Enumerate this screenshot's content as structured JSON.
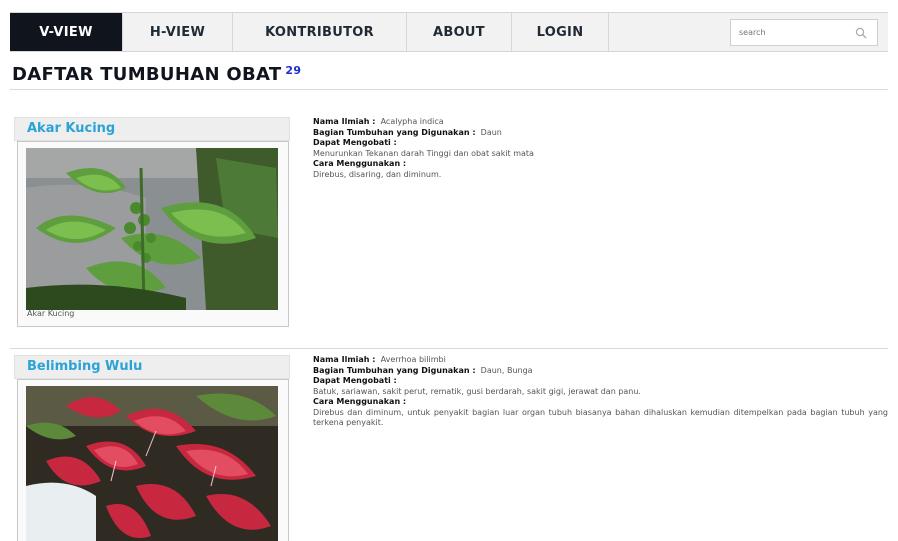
{
  "nav": {
    "items": [
      {
        "label": "V-VIEW",
        "active": true
      },
      {
        "label": "H-VIEW",
        "active": false
      },
      {
        "label": "KONTRIBUTOR",
        "active": false
      },
      {
        "label": "ABOUT",
        "active": false
      },
      {
        "label": "LOGIN",
        "active": false
      }
    ],
    "search_placeholder": "search",
    "search_icon": "magnifier-icon"
  },
  "page": {
    "title": "DAFTAR TUMBUHAN OBAT",
    "count": "29"
  },
  "plants": [
    {
      "name": "Akar Kucing",
      "caption": "Akar Kucing",
      "labels": {
        "ilmiah": "Nama Ilmiah :",
        "bagian": "Bagian Tumbuhan yang Digunakan :",
        "mengobati": "Dapat Mengobati :",
        "cara": "Cara Menggunakan :"
      },
      "nama_ilmiah": "Acalypha indica",
      "bagian": "Daun",
      "mengobati": "Menurunkan Tekanan darah Tinggi dan obat sakit mata",
      "cara": "Direbus, disaring, dan diminum."
    },
    {
      "name": "Belimbing Wulu",
      "caption": "",
      "labels": {
        "ilmiah": "Nama Ilmiah :",
        "bagian": "Bagian Tumbuhan yang Digunakan :",
        "mengobati": "Dapat Mengobati :",
        "cara": "Cara Menggunakan :"
      },
      "nama_ilmiah": "Averrhoa bilimbi",
      "bagian": "Daun, Bunga",
      "mengobati": "Batuk, sariawan, sakit perut, rematik, gusi berdarah, sakit gigi, jerawat dan panu.",
      "cara": "Direbus dan diminum, untuk penyakit bagian luar organ tubuh biasanya bahan dihaluskan kemudian ditempelkan pada bagian tubuh yang terkena penyakit."
    }
  ],
  "colors": {
    "nav_active_bg": "#10151d",
    "plant_name": "#2aa3d6",
    "count": "#1a2fcf"
  }
}
